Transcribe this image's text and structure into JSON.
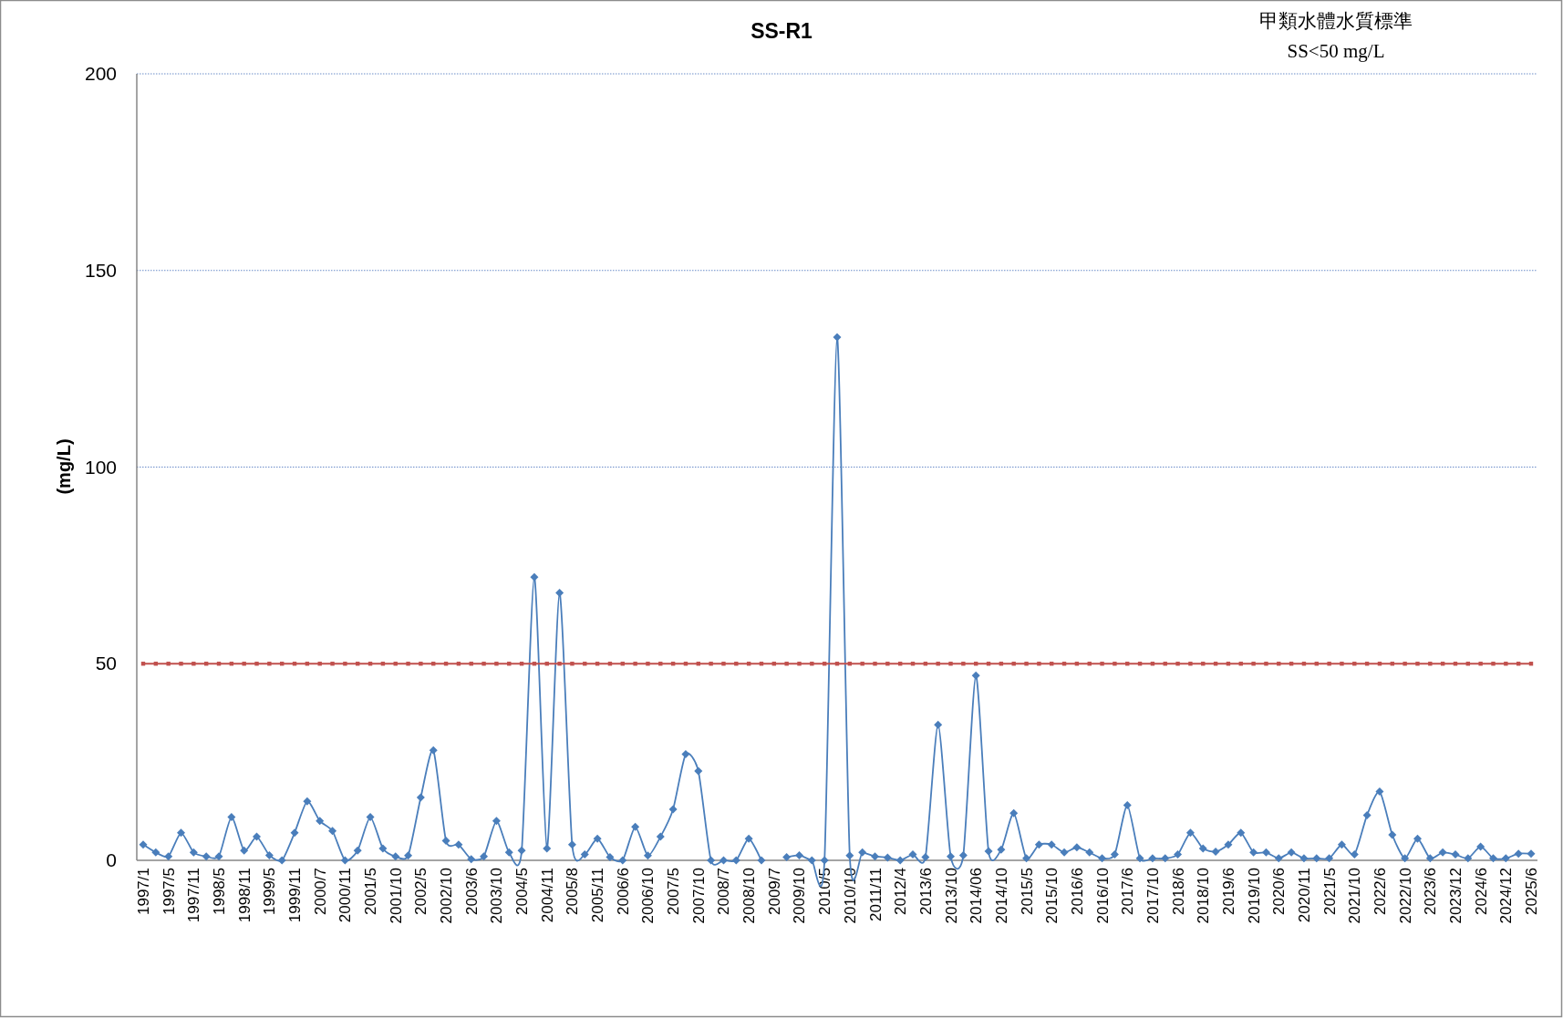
{
  "chart": {
    "chart_data": {
      "type": "line",
      "title": "SS-R1",
      "ylabel": "(mg/L)",
      "ylim": [
        0,
        200
      ],
      "yticks": [
        0,
        50,
        100,
        150,
        200
      ],
      "categories": [
        "1997/1",
        null,
        "1997/5",
        null,
        "1997/11",
        null,
        "1998/5",
        null,
        "1998/11",
        null,
        "1999/5",
        null,
        "1999/11",
        null,
        "2000/7",
        null,
        "2000/11",
        null,
        "2001/5",
        null,
        "2001/10",
        null,
        "2002/5",
        null,
        "2002/10",
        null,
        "2003/6",
        null,
        "2003/10",
        null,
        "2004/5",
        null,
        "2004/11",
        null,
        "2005/8",
        null,
        "2005/11",
        null,
        "2006/6",
        null,
        "2006/10",
        null,
        "2007/5",
        null,
        "2007/10",
        null,
        "2008/7",
        null,
        "2008/10",
        null,
        "2009/7",
        null,
        "2009/10",
        null,
        "2010/5",
        null,
        "2010/10",
        null,
        "2011/11",
        null,
        "2012/4",
        null,
        "2013/6",
        null,
        "2013/10",
        null,
        "2014/06",
        null,
        "2014/10",
        null,
        "2015/5",
        null,
        "2015/10",
        null,
        "2016/6",
        null,
        "2016/10",
        null,
        "2017/6",
        null,
        "2017/10",
        null,
        "2018/6",
        null,
        "2018/10",
        null,
        "2019/6",
        null,
        "2019/10",
        null,
        "2020/6",
        null,
        "2020/11",
        null,
        "2021/5",
        null,
        "2021/10",
        null,
        "2022/6",
        null,
        "2022/10",
        null,
        "2023/6",
        null,
        "2023/12",
        null,
        "2024/6",
        null,
        "2024/12",
        null,
        "2025/6"
      ],
      "series": [
        {
          "color": "#4a7ebb",
          "marker": "diamond",
          "values": [
            4,
            2,
            1,
            7,
            2,
            1,
            1,
            11,
            2.5,
            6,
            1.3,
            0,
            7,
            15,
            10,
            7.5,
            0,
            2.5,
            11,
            3,
            1,
            1.2,
            16,
            28,
            5,
            4,
            0.3,
            1,
            10,
            2,
            2.5,
            72,
            3,
            68,
            4,
            1.5,
            5.5,
            0.8,
            0,
            8.5,
            1.2,
            6,
            13,
            27,
            22.7,
            0,
            0,
            0,
            5.5,
            0,
            null,
            0.8,
            1.3,
            0,
            0,
            133,
            1.2,
            2,
            1,
            0.7,
            0,
            1.5,
            0.8,
            34.5,
            1,
            1.3,
            47,
            2.3,
            2.7,
            12,
            0.5,
            4,
            4,
            2,
            3.3,
            2,
            0.5,
            1.5,
            14,
            0.5,
            0.5,
            0.5,
            1.5,
            7,
            3,
            2.2,
            4,
            7,
            2,
            2,
            0.5,
            2,
            0.5,
            0.5,
            0.5,
            4,
            1.5,
            11.5,
            17.5,
            6.5,
            0.5,
            5.5,
            0.5,
            2,
            1.5,
            0.5,
            3.5,
            0.5,
            0.5,
            1.7,
            1.7
          ]
        },
        {
          "color": "#c0504d",
          "marker": "square",
          "values": [
            50,
            50,
            50,
            50,
            50,
            50,
            50,
            50,
            50,
            50,
            50,
            50,
            50,
            50,
            50,
            50,
            50,
            50,
            50,
            50,
            50,
            50,
            50,
            50,
            50,
            50,
            50,
            50,
            50,
            50,
            50,
            50,
            50,
            50,
            50,
            50,
            50,
            50,
            50,
            50,
            50,
            50,
            50,
            50,
            50,
            50,
            50,
            50,
            50,
            50,
            50,
            50,
            50,
            50,
            50,
            50,
            50,
            50,
            50,
            50,
            50,
            50,
            50,
            50,
            50,
            50,
            50,
            50,
            50,
            50,
            50,
            50,
            50,
            50,
            50,
            50,
            50,
            50,
            50,
            50,
            50,
            50,
            50,
            50,
            50,
            50,
            50,
            50,
            50,
            50,
            50,
            50,
            50,
            50,
            50,
            50,
            50,
            50,
            50,
            50,
            50,
            50,
            50,
            50,
            50,
            50,
            50,
            50,
            50,
            50,
            50
          ]
        }
      ],
      "annotations": [
        "甲類水體水質標準",
        "SS<50 mg/L"
      ]
    }
  }
}
